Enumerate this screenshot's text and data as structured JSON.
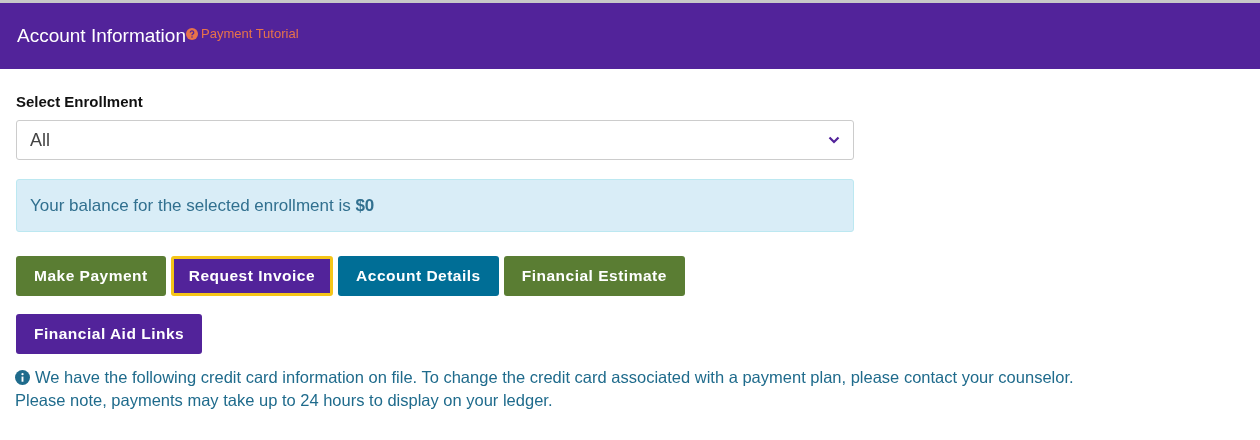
{
  "header": {
    "title": "Account Information",
    "tutorial_link": "Payment Tutorial"
  },
  "enrollment": {
    "label": "Select Enrollment",
    "value": "All"
  },
  "balance_alert": {
    "text": "Your balance for the selected enrollment is **$0**"
  },
  "buttons": [
    {
      "label": "Make Payment",
      "color": "#5a7d33",
      "focused": false
    },
    {
      "label": "Request Invoice",
      "color": "#52239a",
      "focused": true
    },
    {
      "label": "Account Details",
      "color": "#006e96",
      "focused": false
    },
    {
      "label": "Financial Estimate",
      "color": "#5a7d33",
      "focused": false
    },
    {
      "label": "Financial Aid Links",
      "color": "#52239a",
      "focused": false
    }
  ],
  "note": {
    "lines": [
      "We have the following credit card information on file. To change the credit card associated with a payment plan, please contact your counselor.",
      "Please note, payments may take up to 24 hours to display on your ledger."
    ]
  }
}
